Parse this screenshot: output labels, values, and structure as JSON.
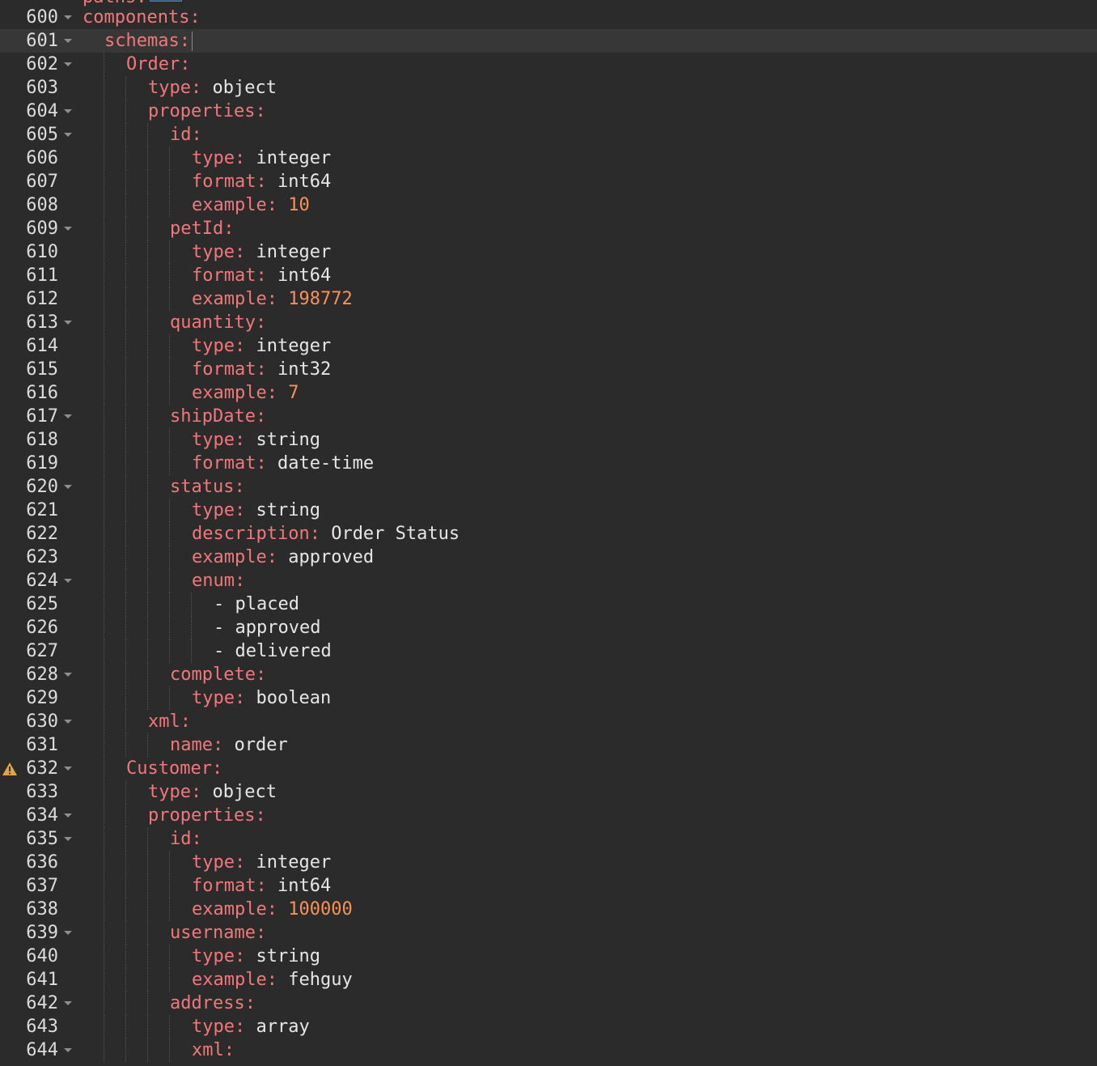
{
  "editor": {
    "language": "yaml",
    "active_line": 601,
    "clipped_top_line": {
      "text": "paths:"
    },
    "lines": [
      {
        "n": "600",
        "indent": 0,
        "fold": true,
        "key": "components:",
        "val": "",
        "kind": "key"
      },
      {
        "n": "601",
        "indent": 1,
        "fold": true,
        "key": "schemas:",
        "val": "",
        "kind": "key",
        "cursor": true
      },
      {
        "n": "602",
        "indent": 2,
        "fold": true,
        "key": "Order:",
        "val": "",
        "kind": "key"
      },
      {
        "n": "603",
        "indent": 3,
        "fold": false,
        "key": "type:",
        "val": " object",
        "kind": "str"
      },
      {
        "n": "604",
        "indent": 3,
        "fold": true,
        "key": "properties:",
        "val": "",
        "kind": "key"
      },
      {
        "n": "605",
        "indent": 4,
        "fold": true,
        "key": "id:",
        "val": "",
        "kind": "key"
      },
      {
        "n": "606",
        "indent": 5,
        "fold": false,
        "key": "type:",
        "val": " integer",
        "kind": "str"
      },
      {
        "n": "607",
        "indent": 5,
        "fold": false,
        "key": "format:",
        "val": " int64",
        "kind": "str"
      },
      {
        "n": "608",
        "indent": 5,
        "fold": false,
        "key": "example:",
        "val": " 10",
        "kind": "num"
      },
      {
        "n": "609",
        "indent": 4,
        "fold": true,
        "key": "petId:",
        "val": "",
        "kind": "key"
      },
      {
        "n": "610",
        "indent": 5,
        "fold": false,
        "key": "type:",
        "val": " integer",
        "kind": "str"
      },
      {
        "n": "611",
        "indent": 5,
        "fold": false,
        "key": "format:",
        "val": " int64",
        "kind": "str"
      },
      {
        "n": "612",
        "indent": 5,
        "fold": false,
        "key": "example:",
        "val": " 198772",
        "kind": "num"
      },
      {
        "n": "613",
        "indent": 4,
        "fold": true,
        "key": "quantity:",
        "val": "",
        "kind": "key"
      },
      {
        "n": "614",
        "indent": 5,
        "fold": false,
        "key": "type:",
        "val": " integer",
        "kind": "str"
      },
      {
        "n": "615",
        "indent": 5,
        "fold": false,
        "key": "format:",
        "val": " int32",
        "kind": "str"
      },
      {
        "n": "616",
        "indent": 5,
        "fold": false,
        "key": "example:",
        "val": " 7",
        "kind": "num"
      },
      {
        "n": "617",
        "indent": 4,
        "fold": true,
        "key": "shipDate:",
        "val": "",
        "kind": "key"
      },
      {
        "n": "618",
        "indent": 5,
        "fold": false,
        "key": "type:",
        "val": " string",
        "kind": "str"
      },
      {
        "n": "619",
        "indent": 5,
        "fold": false,
        "key": "format:",
        "val": " date-time",
        "kind": "str"
      },
      {
        "n": "620",
        "indent": 4,
        "fold": true,
        "key": "status:",
        "val": "",
        "kind": "key"
      },
      {
        "n": "621",
        "indent": 5,
        "fold": false,
        "key": "type:",
        "val": " string",
        "kind": "str"
      },
      {
        "n": "622",
        "indent": 5,
        "fold": false,
        "key": "description:",
        "val": " Order Status",
        "kind": "str"
      },
      {
        "n": "623",
        "indent": 5,
        "fold": false,
        "key": "example:",
        "val": " approved",
        "kind": "str"
      },
      {
        "n": "624",
        "indent": 5,
        "fold": true,
        "key": "enum:",
        "val": "",
        "kind": "key"
      },
      {
        "n": "625",
        "indent": 6,
        "fold": false,
        "key": "",
        "val": "- placed",
        "kind": "str"
      },
      {
        "n": "626",
        "indent": 6,
        "fold": false,
        "key": "",
        "val": "- approved",
        "kind": "str"
      },
      {
        "n": "627",
        "indent": 6,
        "fold": false,
        "key": "",
        "val": "- delivered",
        "kind": "str"
      },
      {
        "n": "628",
        "indent": 4,
        "fold": true,
        "key": "complete:",
        "val": "",
        "kind": "key"
      },
      {
        "n": "629",
        "indent": 5,
        "fold": false,
        "key": "type:",
        "val": " boolean",
        "kind": "str"
      },
      {
        "n": "630",
        "indent": 3,
        "fold": true,
        "key": "xml:",
        "val": "",
        "kind": "key"
      },
      {
        "n": "631",
        "indent": 4,
        "fold": false,
        "key": "name:",
        "val": " order",
        "kind": "str"
      },
      {
        "n": "632",
        "indent": 2,
        "fold": true,
        "key": "Customer:",
        "val": "",
        "kind": "key",
        "warning": true
      },
      {
        "n": "633",
        "indent": 3,
        "fold": false,
        "key": "type:",
        "val": " object",
        "kind": "str"
      },
      {
        "n": "634",
        "indent": 3,
        "fold": true,
        "key": "properties:",
        "val": "",
        "kind": "key"
      },
      {
        "n": "635",
        "indent": 4,
        "fold": true,
        "key": "id:",
        "val": "",
        "kind": "key"
      },
      {
        "n": "636",
        "indent": 5,
        "fold": false,
        "key": "type:",
        "val": " integer",
        "kind": "str"
      },
      {
        "n": "637",
        "indent": 5,
        "fold": false,
        "key": "format:",
        "val": " int64",
        "kind": "str"
      },
      {
        "n": "638",
        "indent": 5,
        "fold": false,
        "key": "example:",
        "val": " 100000",
        "kind": "num"
      },
      {
        "n": "639",
        "indent": 4,
        "fold": true,
        "key": "username:",
        "val": "",
        "kind": "key"
      },
      {
        "n": "640",
        "indent": 5,
        "fold": false,
        "key": "type:",
        "val": " string",
        "kind": "str"
      },
      {
        "n": "641",
        "indent": 5,
        "fold": false,
        "key": "example:",
        "val": " fehguy",
        "kind": "str"
      },
      {
        "n": "642",
        "indent": 4,
        "fold": true,
        "key": "address:",
        "val": "",
        "kind": "key"
      },
      {
        "n": "643",
        "indent": 5,
        "fold": false,
        "key": "type:",
        "val": " array",
        "kind": "str"
      },
      {
        "n": "644",
        "indent": 5,
        "fold": true,
        "key": "xml:",
        "val": "",
        "kind": "key"
      }
    ]
  },
  "icons": {
    "fold": "fold-arrow-icon",
    "warning": "warning-icon"
  },
  "colors": {
    "background": "#2b2b2b",
    "active_line": "#373737",
    "key": "#f2777a",
    "value": "#e6e6e6",
    "number": "#f99157",
    "line_number": "#dcdcdc",
    "warning": "#e2a53a"
  }
}
